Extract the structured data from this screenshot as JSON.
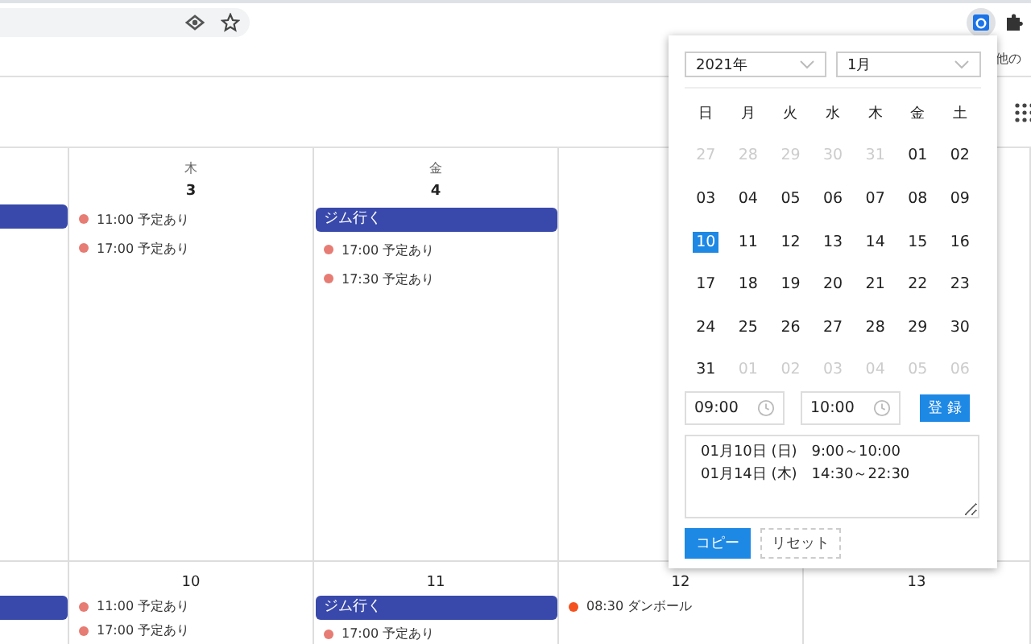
{
  "bookmarks_bar": {
    "overflow_label": "他の"
  },
  "calendar": {
    "weeks": [
      {
        "days": [
          {
            "events": [
              {
                "kind": "bar"
              }
            ]
          },
          {
            "weekday": "木",
            "date": "3",
            "events": [
              {
                "kind": "timed",
                "time": "11:00",
                "title": "予定あり",
                "color": "#e67c73"
              },
              {
                "kind": "timed",
                "time": "17:00",
                "title": "予定あり",
                "color": "#e67c73"
              }
            ]
          },
          {
            "weekday": "金",
            "date": "4",
            "events": [
              {
                "kind": "bar",
                "title": "ジム行く"
              },
              {
                "kind": "timed",
                "time": "17:00",
                "title": "予定あり",
                "color": "#e67c73"
              },
              {
                "kind": "timed",
                "time": "17:30",
                "title": "予定あり",
                "color": "#e67c73"
              }
            ]
          }
        ]
      },
      {
        "days": [
          {
            "events": [
              {
                "kind": "bar"
              }
            ]
          },
          {
            "date": "10",
            "events": [
              {
                "kind": "timed",
                "time": "11:00",
                "title": "予定あり",
                "color": "#e67c73"
              },
              {
                "kind": "timed",
                "time": "17:00",
                "title": "予定あり",
                "color": "#e67c73"
              }
            ]
          },
          {
            "date": "11",
            "events": [
              {
                "kind": "bar",
                "title": "ジム行く"
              },
              {
                "kind": "timed",
                "time": "17:00",
                "title": "予定あり",
                "color": "#e67c73"
              }
            ]
          },
          {
            "date": "12",
            "events": [
              {
                "kind": "timed",
                "time": "08:30",
                "title": "ダンボール",
                "color": "#f4511e"
              }
            ]
          },
          {
            "date": "13"
          }
        ]
      }
    ]
  },
  "popup": {
    "year": "2021年",
    "month": "1月",
    "weekdays": [
      "日",
      "月",
      "火",
      "水",
      "木",
      "金",
      "土"
    ],
    "days": [
      {
        "label": "27",
        "muted": true,
        "selected": false
      },
      {
        "label": "28",
        "muted": true,
        "selected": false
      },
      {
        "label": "29",
        "muted": true,
        "selected": false
      },
      {
        "label": "30",
        "muted": true,
        "selected": false
      },
      {
        "label": "31",
        "muted": true,
        "selected": false
      },
      {
        "label": "01",
        "muted": false,
        "selected": false
      },
      {
        "label": "02",
        "muted": false,
        "selected": false
      },
      {
        "label": "03",
        "muted": false,
        "selected": false
      },
      {
        "label": "04",
        "muted": false,
        "selected": false
      },
      {
        "label": "05",
        "muted": false,
        "selected": false
      },
      {
        "label": "06",
        "muted": false,
        "selected": false
      },
      {
        "label": "07",
        "muted": false,
        "selected": false
      },
      {
        "label": "08",
        "muted": false,
        "selected": false
      },
      {
        "label": "09",
        "muted": false,
        "selected": false
      },
      {
        "label": "10",
        "muted": false,
        "selected": true
      },
      {
        "label": "11",
        "muted": false,
        "selected": false
      },
      {
        "label": "12",
        "muted": false,
        "selected": false
      },
      {
        "label": "13",
        "muted": false,
        "selected": false
      },
      {
        "label": "14",
        "muted": false,
        "selected": false
      },
      {
        "label": "15",
        "muted": false,
        "selected": false
      },
      {
        "label": "16",
        "muted": false,
        "selected": false
      },
      {
        "label": "17",
        "muted": false,
        "selected": false
      },
      {
        "label": "18",
        "muted": false,
        "selected": false
      },
      {
        "label": "19",
        "muted": false,
        "selected": false
      },
      {
        "label": "20",
        "muted": false,
        "selected": false
      },
      {
        "label": "21",
        "muted": false,
        "selected": false
      },
      {
        "label": "22",
        "muted": false,
        "selected": false
      },
      {
        "label": "23",
        "muted": false,
        "selected": false
      },
      {
        "label": "24",
        "muted": false,
        "selected": false
      },
      {
        "label": "25",
        "muted": false,
        "selected": false
      },
      {
        "label": "26",
        "muted": false,
        "selected": false
      },
      {
        "label": "27",
        "muted": false,
        "selected": false
      },
      {
        "label": "28",
        "muted": false,
        "selected": false
      },
      {
        "label": "29",
        "muted": false,
        "selected": false
      },
      {
        "label": "30",
        "muted": false,
        "selected": false
      },
      {
        "label": "31",
        "muted": false,
        "selected": false
      },
      {
        "label": "01",
        "muted": true,
        "selected": false
      },
      {
        "label": "02",
        "muted": true,
        "selected": false
      },
      {
        "label": "03",
        "muted": true,
        "selected": false
      },
      {
        "label": "04",
        "muted": true,
        "selected": false
      },
      {
        "label": "05",
        "muted": true,
        "selected": false
      },
      {
        "label": "06",
        "muted": true,
        "selected": false
      }
    ],
    "start_time": "09:00",
    "end_time": "10:00",
    "register_button": "登 録",
    "schedule_text": "01月10日 (日)　9:00～10:00\n01月14日 (木)　14:30～22:30",
    "buttons": [
      {
        "label": "コピー",
        "kind": "primary"
      },
      {
        "label": "リセット",
        "kind": "dashed"
      }
    ]
  }
}
